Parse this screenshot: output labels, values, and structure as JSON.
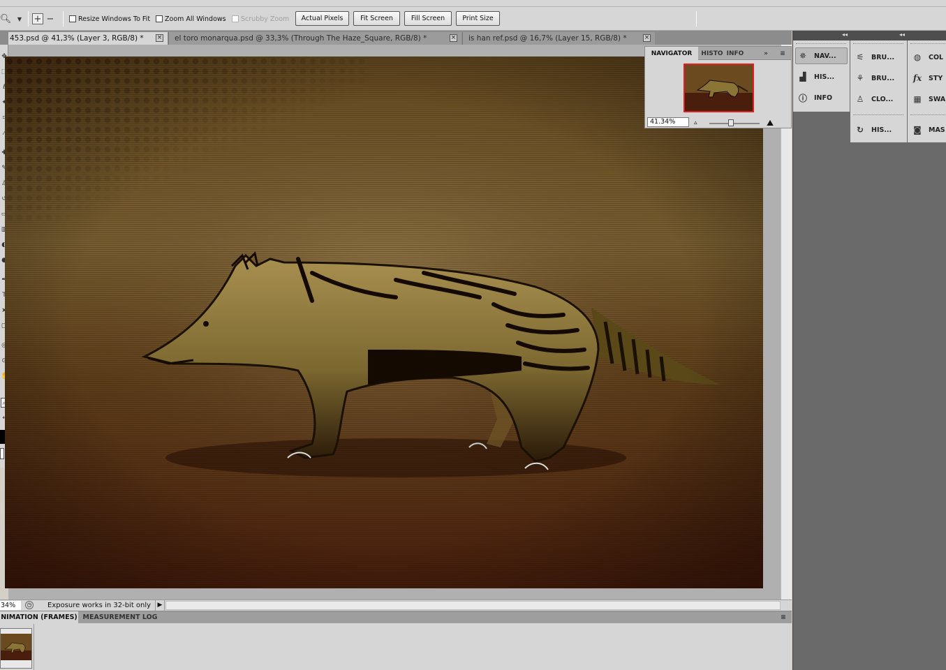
{
  "options_bar": {
    "tool_icon": "zoom-icon",
    "zoom_in_icon": "zoom-in-icon",
    "zoom_out_icon": "zoom-out-icon",
    "resize_windows_label": "Resize Windows To Fit",
    "zoom_all_label": "Zoom All Windows",
    "scrubby_zoom_label": "Scrubby Zoom",
    "actual_pixels": "Actual Pixels",
    "fit_screen": "Fit Screen",
    "fill_screen": "Fill Screen",
    "print_size": "Print Size"
  },
  "doc_tabs": [
    {
      "label": "453.psd @ 41,3% (Layer 3, RGB/8) *",
      "close": "×"
    },
    {
      "label": "el toro monarqua.psd @ 33,3% (Through The Haze_Square, RGB/8) *",
      "close": "×"
    },
    {
      "label": "is han ref.psd @ 16,7% (Layer 15, RGB/8) *",
      "close": "×"
    }
  ],
  "navigator": {
    "tabs": [
      "NAVIGATOR",
      "HISTO",
      "INFO"
    ],
    "zoom_value": "41.34%",
    "menu_icon": "panel-menu-icon"
  },
  "status_bar": {
    "zoom": "34%",
    "message": "Exposure works in 32-bit only",
    "arrow": "▶"
  },
  "bottom_panel": {
    "tabs": [
      "NIMATION (FRAMES)",
      "MEASUREMENT LOG"
    ]
  },
  "dock": {
    "column1": [
      {
        "label": "NAV...",
        "icon": "navigator-icon",
        "active": true
      },
      {
        "label": "HIS...",
        "icon": "histogram-icon",
        "active": false
      },
      {
        "label": "INFO",
        "icon": "info-icon",
        "active": false
      }
    ],
    "column2": [
      {
        "label": "BRU...",
        "icon": "brushes-icon"
      },
      {
        "label": "BRU...",
        "icon": "brush-presets-icon"
      },
      {
        "label": "CLO...",
        "icon": "clone-source-icon"
      },
      {
        "label": "HIS...",
        "icon": "history-icon"
      }
    ],
    "column3": [
      {
        "label": "COL",
        "icon": "color-icon"
      },
      {
        "label": "STY",
        "icon": "styles-icon"
      },
      {
        "label": "SWA",
        "icon": "swatches-icon"
      },
      {
        "label": "MAS",
        "icon": "masks-icon"
      }
    ]
  },
  "colors": {
    "foreground": "#000000",
    "background": "#ffffff",
    "navigator_frame": "#e02020"
  }
}
